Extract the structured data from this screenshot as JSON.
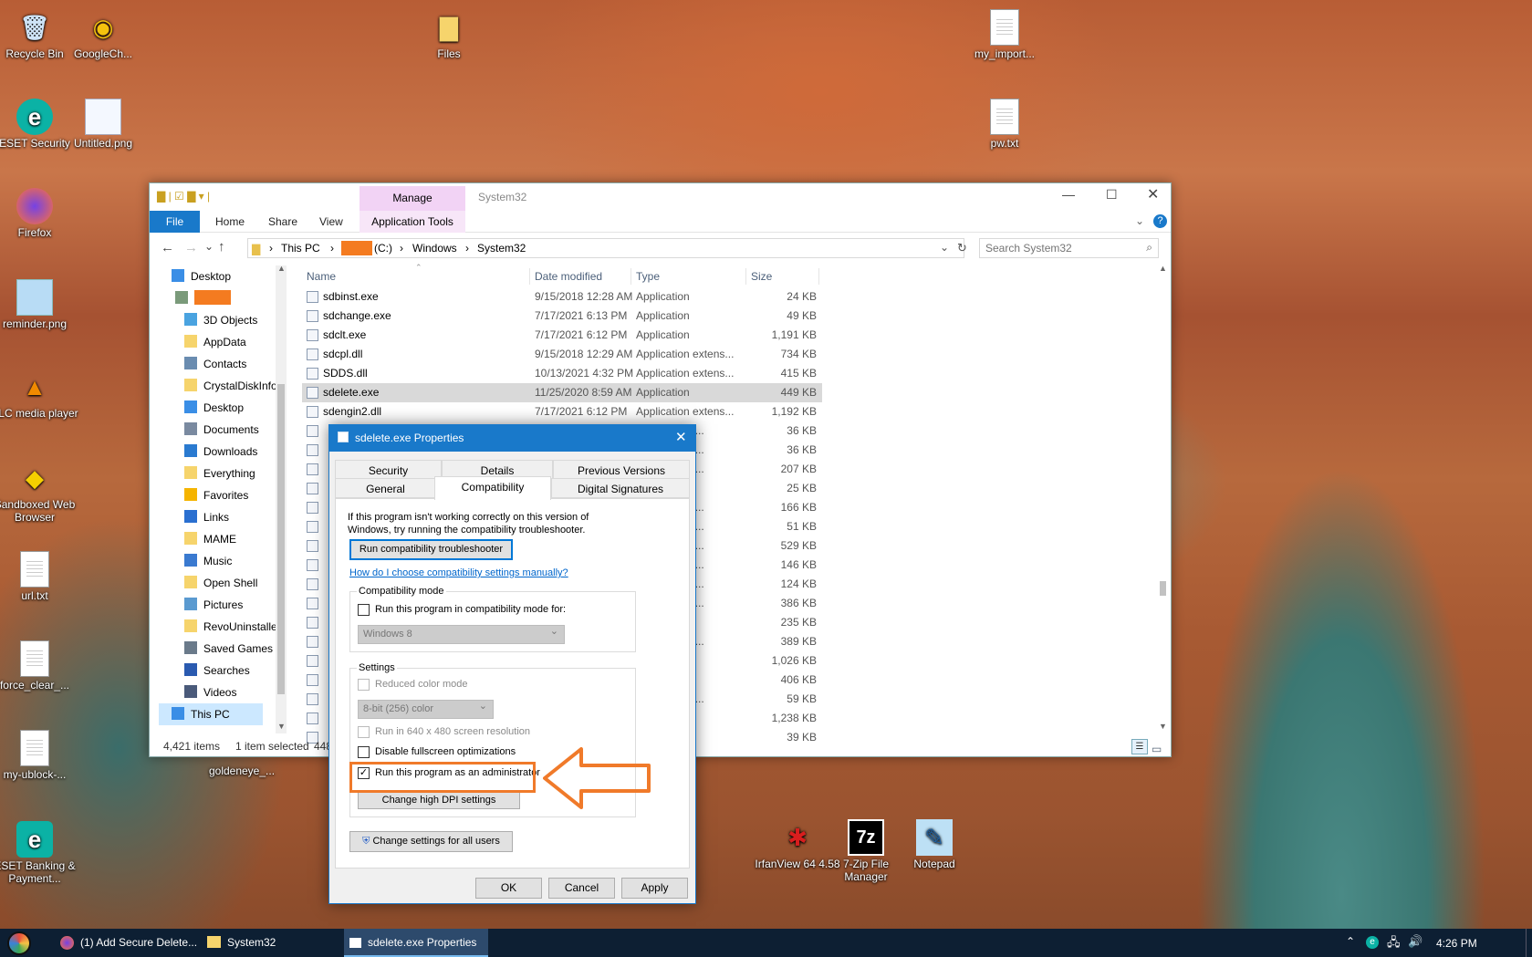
{
  "desktop": {
    "icons": [
      {
        "label": "Recycle Bin",
        "glyph": "🗑",
        "icon": "recycle-bin-icon"
      },
      {
        "label": "GoogleCh...",
        "glyph": "◉",
        "icon": "chrome-icon"
      },
      {
        "label": "Files",
        "glyph": "📁",
        "icon": "folder-icon"
      },
      {
        "label": "my_import...",
        "glyph": "",
        "icon": "text-file-icon"
      },
      {
        "label": "ESET Security",
        "glyph": "e",
        "icon": "eset-icon"
      },
      {
        "label": "Untitled.png",
        "glyph": "",
        "icon": "image-file-icon"
      },
      {
        "label": "pw.txt",
        "glyph": "",
        "icon": "text-file-icon"
      },
      {
        "label": "Firefox",
        "glyph": "🦊",
        "icon": "firefox-icon"
      },
      {
        "label": "reminder.png",
        "glyph": "",
        "icon": "image-file-icon"
      },
      {
        "label": "VLC media player",
        "glyph": "▲",
        "icon": "vlc-icon"
      },
      {
        "label": "Sandboxed Web Browser",
        "glyph": "◆",
        "icon": "sandboxed-browser-icon"
      },
      {
        "label": "url.txt",
        "glyph": "",
        "icon": "text-file-icon"
      },
      {
        "label": "force_clear_...",
        "glyph": "",
        "icon": "text-file-icon"
      },
      {
        "label": "my-ublock-...",
        "glyph": "",
        "icon": "text-file-icon"
      },
      {
        "label": "goldeneye_...",
        "glyph": "",
        "icon": "file-icon"
      },
      {
        "label": "ESET Banking & Payment...",
        "glyph": "e",
        "icon": "eset-banking-icon"
      },
      {
        "label": "IrfanView 64 4.58",
        "glyph": "✱",
        "icon": "irfanview-icon"
      },
      {
        "label": "7-Zip File Manager",
        "glyph": "7z",
        "icon": "7zip-icon"
      },
      {
        "label": "Notepad",
        "glyph": "✎",
        "icon": "notepad-icon"
      }
    ]
  },
  "explorer": {
    "title": "System32",
    "manage_tab": "Manage",
    "app_tools_tab": "Application Tools",
    "ribbon_tabs": [
      "File",
      "Home",
      "Share",
      "View"
    ],
    "breadcrumb": [
      "This PC",
      "(C:)",
      "Windows",
      "System32"
    ],
    "search_placeholder": "Search System32",
    "columns": {
      "name": "Name",
      "date": "Date modified",
      "type": "Type",
      "size": "Size"
    },
    "nav": [
      {
        "label": "Desktop",
        "icon": "desktop-icon"
      },
      {
        "label": "",
        "icon": "user-icon"
      },
      {
        "label": "3D Objects",
        "icon": "3d-objects-icon"
      },
      {
        "label": "AppData",
        "icon": "folder-icon"
      },
      {
        "label": "Contacts",
        "icon": "contacts-icon"
      },
      {
        "label": "CrystalDiskInfo",
        "icon": "folder-icon"
      },
      {
        "label": "Desktop",
        "icon": "desktop-icon"
      },
      {
        "label": "Documents",
        "icon": "documents-icon"
      },
      {
        "label": "Downloads",
        "icon": "downloads-icon"
      },
      {
        "label": "Everything",
        "icon": "folder-icon"
      },
      {
        "label": "Favorites",
        "icon": "star-icon"
      },
      {
        "label": "Links",
        "icon": "links-icon"
      },
      {
        "label": "MAME",
        "icon": "folder-icon"
      },
      {
        "label": "Music",
        "icon": "music-icon"
      },
      {
        "label": "Open Shell",
        "icon": "folder-icon"
      },
      {
        "label": "Pictures",
        "icon": "pictures-icon"
      },
      {
        "label": "RevoUninstalle",
        "icon": "folder-icon"
      },
      {
        "label": "Saved Games",
        "icon": "saved-games-icon"
      },
      {
        "label": "Searches",
        "icon": "search-icon"
      },
      {
        "label": "Videos",
        "icon": "videos-icon"
      },
      {
        "label": "This PC",
        "icon": "this-pc-icon"
      }
    ],
    "files": [
      {
        "name": "sdbinst.exe",
        "date": "9/15/2018 12:28 AM",
        "type": "Application",
        "size": "24 KB"
      },
      {
        "name": "sdchange.exe",
        "date": "7/17/2021 6:13 PM",
        "type": "Application",
        "size": "49 KB"
      },
      {
        "name": "sdclt.exe",
        "date": "7/17/2021 6:12 PM",
        "type": "Application",
        "size": "1,191 KB"
      },
      {
        "name": "sdcpl.dll",
        "date": "9/15/2018 12:29 AM",
        "type": "Application extens...",
        "size": "734 KB"
      },
      {
        "name": "SDDS.dll",
        "date": "10/13/2021 4:32 PM",
        "type": "Application extens...",
        "size": "415 KB"
      },
      {
        "name": "sdelete.exe",
        "date": "11/25/2020 8:59 AM",
        "type": "Application",
        "size": "449 KB"
      },
      {
        "name": "sdengin2.dll",
        "date": "7/17/2021 6:12 PM",
        "type": "Application extens...",
        "size": "1,192 KB"
      },
      {
        "name": "",
        "date": "",
        "type": "ation extens...",
        "size": "36 KB"
      },
      {
        "name": "",
        "date": "",
        "type": "ation extens...",
        "size": "36 KB"
      },
      {
        "name": "",
        "date": "",
        "type": "ation extens...",
        "size": "207 KB"
      },
      {
        "name": "",
        "date": "",
        "type": "ation",
        "size": "25 KB"
      },
      {
        "name": "",
        "date": "",
        "type": "ation extens...",
        "size": "166 KB"
      },
      {
        "name": "",
        "date": "",
        "type": "ation extens...",
        "size": "51 KB"
      },
      {
        "name": "",
        "date": "",
        "type": "ation extens...",
        "size": "529 KB"
      },
      {
        "name": "",
        "date": "",
        "type": "ation extens...",
        "size": "146 KB"
      },
      {
        "name": "",
        "date": "",
        "type": "ation extens...",
        "size": "124 KB"
      },
      {
        "name": "",
        "date": "",
        "type": "ation extens...",
        "size": "386 KB"
      },
      {
        "name": "",
        "date": "",
        "type": "ation",
        "size": "235 KB"
      },
      {
        "name": "",
        "date": "",
        "type": "ation extens...",
        "size": "389 KB"
      },
      {
        "name": "",
        "date": "",
        "type": "ation",
        "size": "1,026 KB"
      },
      {
        "name": "",
        "date": "",
        "type": "ation",
        "size": "406 KB"
      },
      {
        "name": "",
        "date": "",
        "type": "ation extens...",
        "size": "59 KB"
      },
      {
        "name": "",
        "date": "",
        "type": "",
        "size": "1,238 KB"
      },
      {
        "name": "",
        "date": "",
        "type": "",
        "size": "39 KB"
      }
    ],
    "status_items": "4,421 items",
    "status_selected": "1 item selected",
    "status_size": "448"
  },
  "dialog": {
    "title": "sdelete.exe Properties",
    "tabs_top": [
      "Security",
      "Details",
      "Previous Versions"
    ],
    "tabs_bottom": [
      "General",
      "Compatibility",
      "Digital Signatures"
    ],
    "intro": "If this program isn't working correctly on this version of Windows, try running the compatibility troubleshooter.",
    "troubleshooter_btn": "Run compatibility troubleshooter",
    "help_link": "How do I choose compatibility settings manually?",
    "compat_group": "Compatibility mode",
    "compat_check": "Run this program in compatibility mode for:",
    "compat_select": "Windows 8",
    "settings_group": "Settings",
    "reduced_color": "Reduced color mode",
    "color_select": "8-bit (256) color",
    "res_640": "Run in 640 x 480 screen resolution",
    "disable_fullscreen": "Disable fullscreen optimizations",
    "run_admin": "Run this program as an administrator",
    "dpi_btn": "Change high DPI settings",
    "all_users_btn": "Change settings for all users",
    "ok": "OK",
    "cancel": "Cancel",
    "apply": "Apply"
  },
  "taskbar": {
    "items": [
      "(1) Add Secure Delete...",
      "System32",
      "sdelete.exe Properties"
    ],
    "time": "4:26 PM"
  },
  "colors": {
    "accent": "#0078d7",
    "highlight": "#f07a2a",
    "manage_tab": "#f2d3f5"
  }
}
